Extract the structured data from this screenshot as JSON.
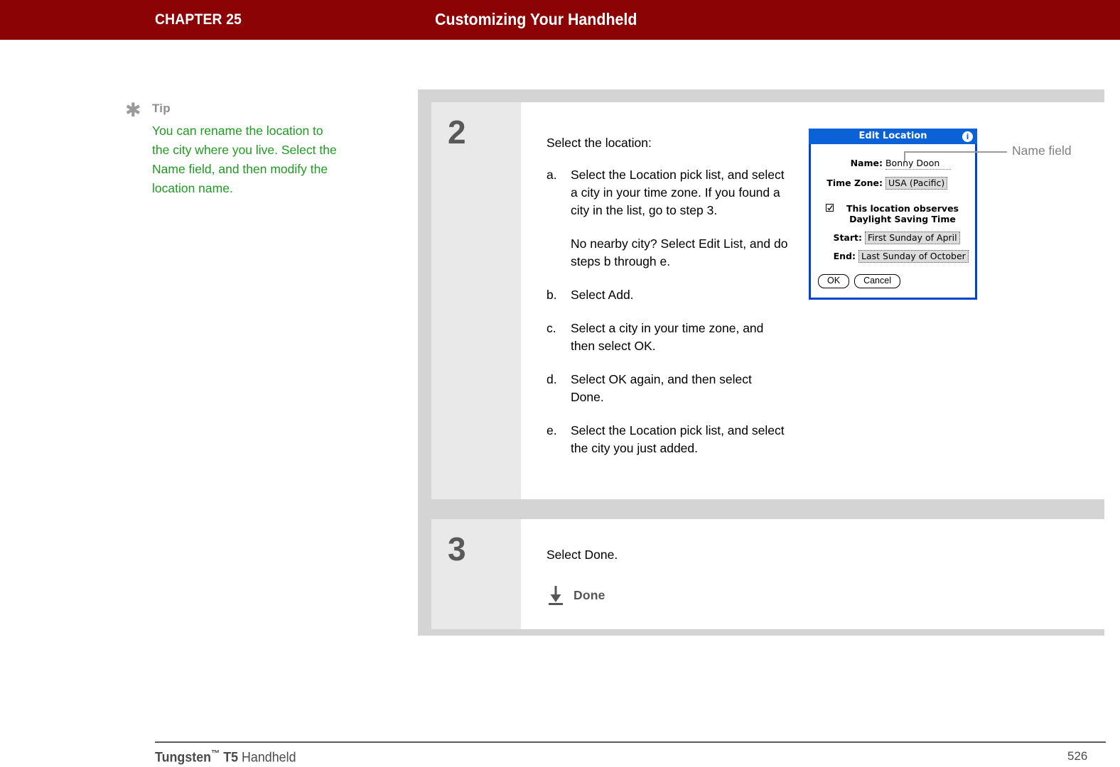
{
  "header": {
    "chapter": "CHAPTER 25",
    "title": "Customizing Your Handheld",
    "bg_color": "#8b0304"
  },
  "tip": {
    "icon": "asterisk-icon",
    "heading": "Tip",
    "body": " You can rename the location to the city where you live. Select the Name field, and then modify the location name.",
    "text_color": "#1f9b21"
  },
  "steps": [
    {
      "number": "2",
      "lead": "Select the location:",
      "items": [
        {
          "marker": "a.",
          "text": "Select the Location pick list, and select a city in your time zone. If you found a city in the list, go to step 3.",
          "text2": "No nearby city? Select Edit List, and do steps b through e."
        },
        {
          "marker": "b.",
          "text": "Select Add.",
          "text2": ""
        },
        {
          "marker": "c.",
          "text": "Select a city in your time zone, and then select OK.",
          "text2": ""
        },
        {
          "marker": "d.",
          "text": "Select OK again, and then select Done.",
          "text2": ""
        },
        {
          "marker": "e.",
          "text": "Select the Location pick list, and select the city you just added.",
          "text2": ""
        }
      ]
    },
    {
      "number": "3",
      "lead": "Select Done.",
      "done_icon": "down-arrow-icon",
      "done_label": "Done"
    }
  ],
  "dialog": {
    "title": "Edit Location",
    "info_icon": "info-icon",
    "title_bg": "#0b62d6",
    "fields": [
      {
        "label": "Name:",
        "value": "Bonny Doon",
        "type": "text"
      },
      {
        "label": "Time Zone:",
        "value": "USA (Pacific)",
        "type": "picklist"
      }
    ],
    "checkbox": {
      "checked": true,
      "line1": "This location observes",
      "line2": "Daylight Saving Time"
    },
    "dst": [
      {
        "label": "Start:",
        "value": "First Sunday of April"
      },
      {
        "label": "End:",
        "value": "Last Sunday of October"
      }
    ],
    "buttons": [
      {
        "label": "OK"
      },
      {
        "label": "Cancel"
      }
    ]
  },
  "callout": {
    "label": "Name field"
  },
  "footer": {
    "brand": "Tungsten",
    "tm": "™",
    "model": " T5",
    "product": " Handheld",
    "page": "526"
  }
}
